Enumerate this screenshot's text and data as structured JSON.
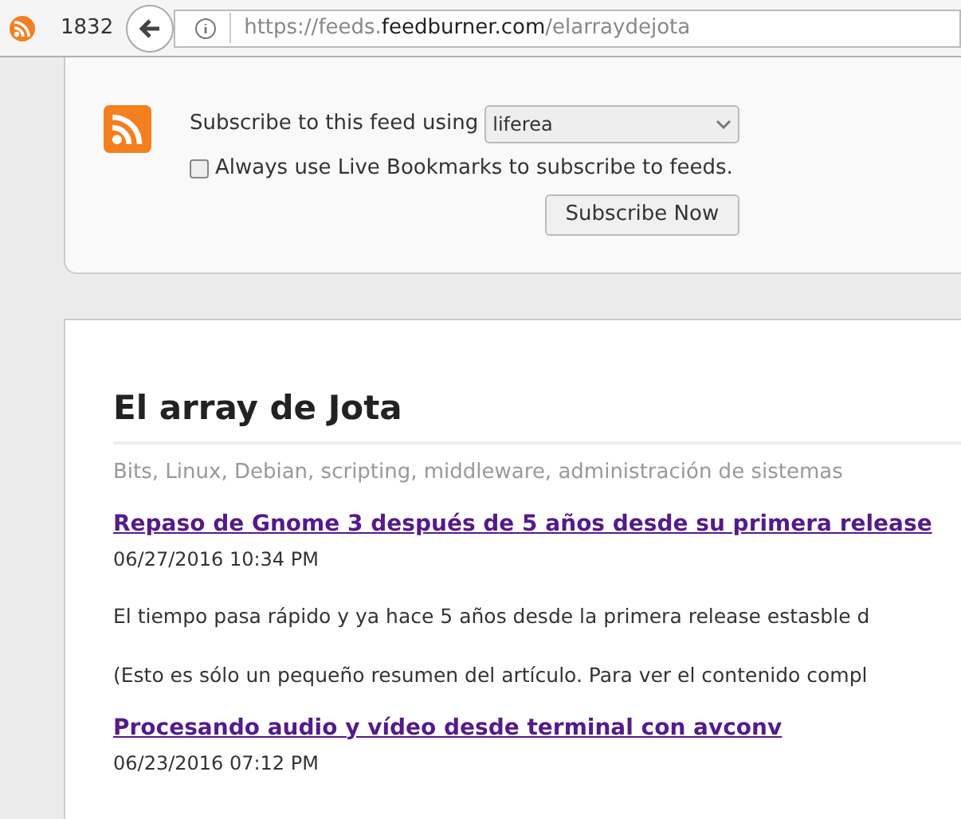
{
  "toolbar": {
    "tab_count": "1832",
    "url": {
      "scheme": "https://feeds.",
      "domain": "feedburner.com",
      "path": "/elarraydejota"
    }
  },
  "subscribe": {
    "label": "Subscribe to this feed using",
    "reader": "liferea",
    "always_live_bookmarks": {
      "label": "Always use Live Bookmarks to subscribe to feeds.",
      "checked": false
    },
    "button": "Subscribe Now"
  },
  "feed": {
    "title": "El array de Jota",
    "subtitle": "Bits, Linux, Debian, scripting, middleware, administración de sistemas",
    "entries": [
      {
        "title": "Repaso de Gnome 3 después de 5 años desde su primera release",
        "date": "06/27/2016 10:34 PM",
        "paragraphs": [
          "El tiempo pasa rápido y ya hace 5 años desde la primera release estasble d",
          "(Esto es sólo un pequeño resumen del artículo. Para ver el contenido compl"
        ]
      },
      {
        "title": "Procesando audio y vídeo desde terminal con avconv",
        "date": "06/23/2016 07:12 PM"
      }
    ]
  }
}
